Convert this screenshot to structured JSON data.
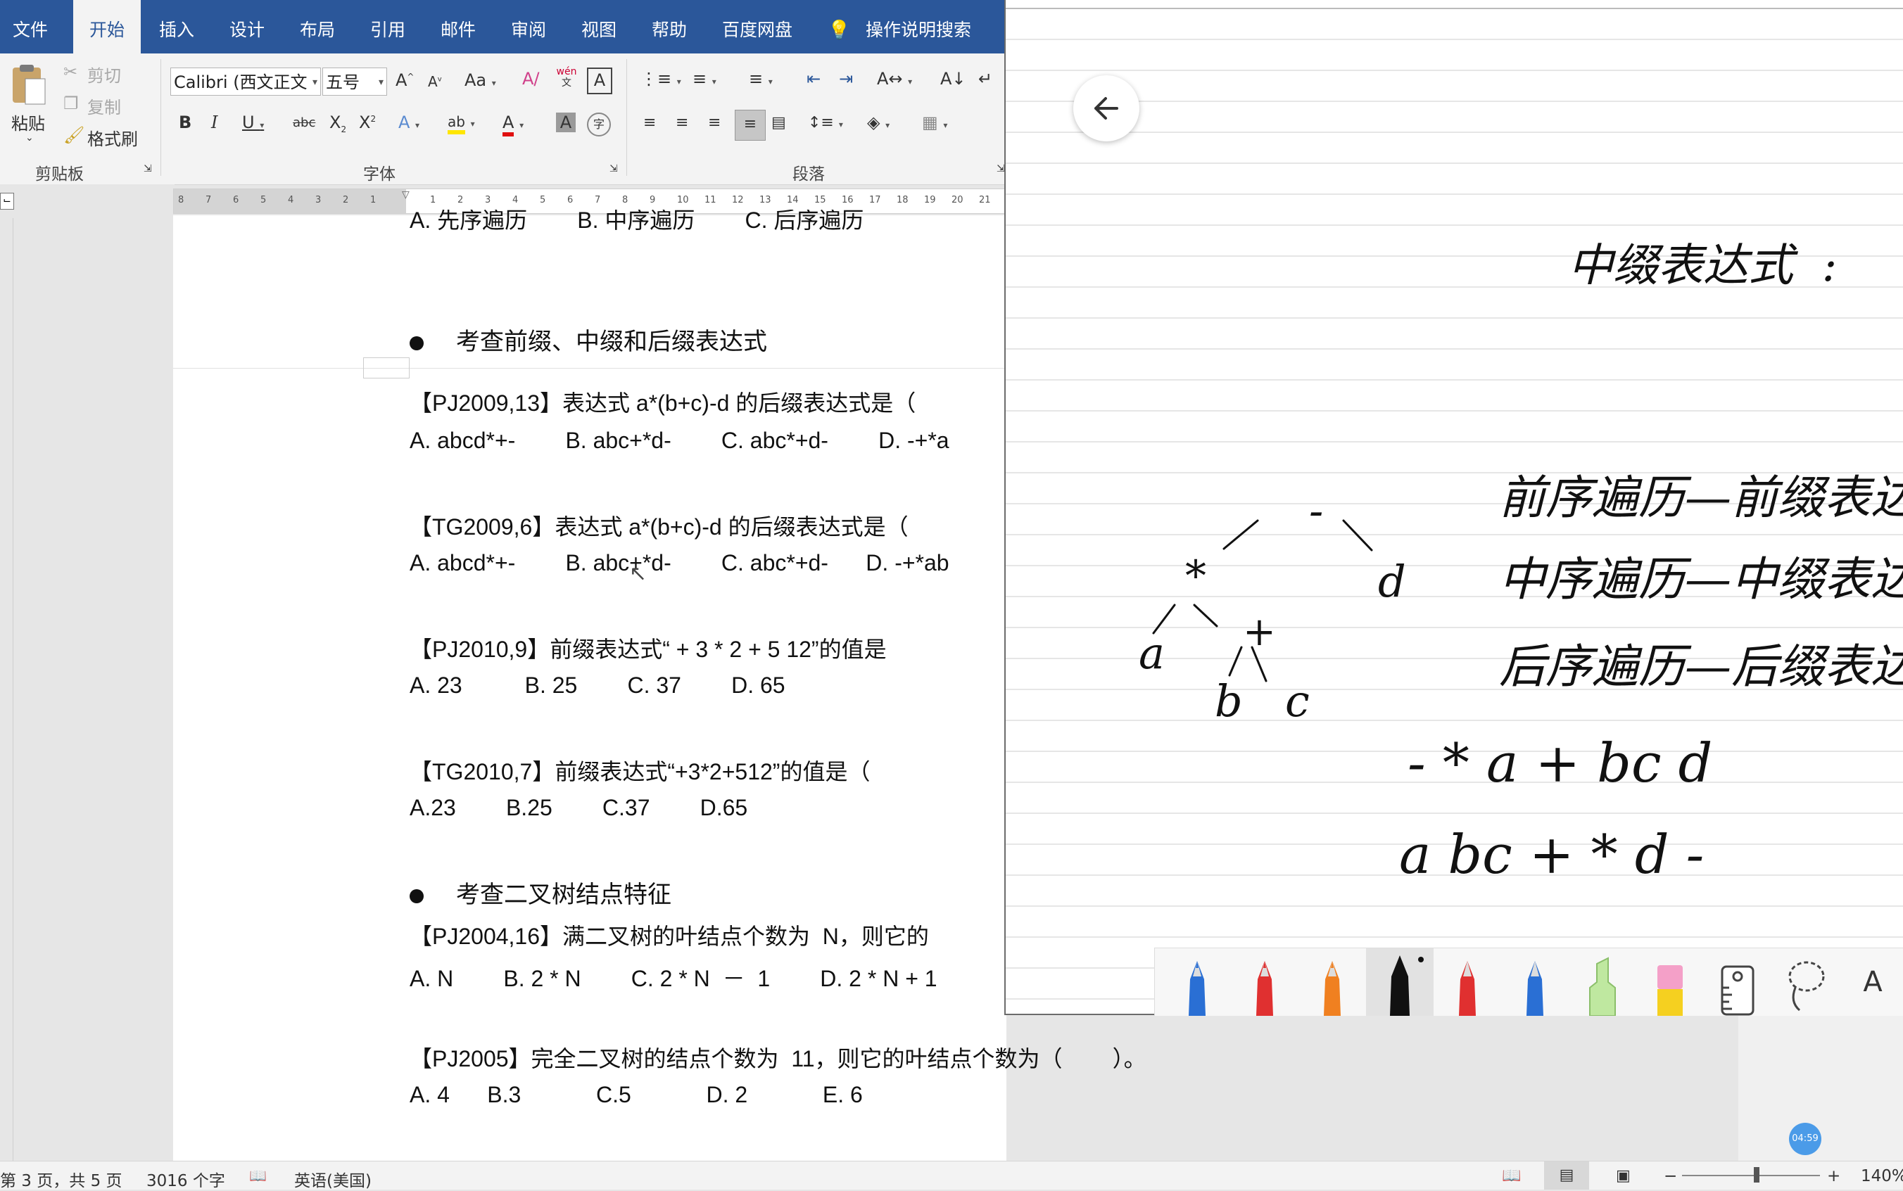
{
  "tabs": [
    "文件",
    "开始",
    "插入",
    "设计",
    "布局",
    "引用",
    "邮件",
    "审阅",
    "视图",
    "帮助",
    "百度网盘",
    "操作说明搜索"
  ],
  "ribbon": {
    "clipboard": {
      "paste": "粘贴",
      "cut": "剪切",
      "copy": "复制",
      "format_painter": "格式刷",
      "group_label": "剪贴板"
    },
    "font": {
      "name": "Calibri (西文正文",
      "size": "五号",
      "group_label": "字体",
      "phonetic_top": "wén",
      "phonetic_bottom": "文"
    },
    "paragraph": {
      "group_label": "段落"
    }
  },
  "ruler_numbers_left": [
    "8",
    "7",
    "6",
    "5",
    "4",
    "3",
    "2",
    "1"
  ],
  "ruler_numbers_right": [
    "1",
    "2",
    "3",
    "4",
    "5",
    "6",
    "7",
    "8",
    "9",
    "10",
    "11",
    "12",
    "13",
    "14",
    "15",
    "16",
    "17",
    "18",
    "19",
    "20",
    "21"
  ],
  "document": {
    "top_partial": "A. 先序遍历        B. 中序遍历        C. 后序遍历",
    "heading1": "考查前缀、中缀和后缀表达式",
    "q1": "【PJ2009,13】表达式 a*(b+c)-d 的后缀表达式是（",
    "q1_opts": "A. abcd*+-        B. abc+*d-        C. abc*+d-        D. -+*a",
    "q2": "【TG2009,6】表达式 a*(b+c)-d 的后缀表达式是（",
    "q2_opts": "A. abcd*+-        B. abc+*d-        C. abc*+d-      D. -+*ab",
    "q3": "【PJ2010,9】前缀表达式“ + 3 * 2 + 5 12”的值是",
    "q3_opts": "A. 23          B. 25        C. 37        D. 65",
    "q4": "【TG2010,7】前缀表达式“+3*2+512”的值是（",
    "q4_opts": "A.23        B.25        C.37        D.65",
    "heading2": "考查二叉树结点特征",
    "q5": "【PJ2004,16】满二叉树的叶结点个数为  N，则它的",
    "q5_opts": "A. N        B. 2 * N        C. 2 * N  －  1        D. 2 * N + 1",
    "q6": "【PJ2005】完全二叉树的结点个数为  11，则它的叶结点个数为（        ）。",
    "q6_opts": "A. 4      B.3            C.5            D. 2            E. 6"
  },
  "status": {
    "page": "第 3 页，共 5 页",
    "words": "3016 个字",
    "language": "英语(美国)",
    "zoom": "140%"
  },
  "timer": "04:59",
  "board_handwriting": [
    "中缀表达式",
    "前序遍历—前缀表达",
    "中序遍历—中缀表达",
    "后序遍历—后缀表达",
    "- * a + bc d",
    "a bc + * d -"
  ],
  "board_tree_nodes": [
    "-",
    "*",
    "d",
    "a",
    "+",
    "b",
    "c"
  ],
  "board_tools": [
    "blue-pen",
    "red-pen",
    "orange-pen",
    "black-marker",
    "red-pen-2",
    "blue-pen-2",
    "green-highlighter",
    "yellow-highlighter",
    "ruler",
    "lasso",
    "text"
  ],
  "board_tool_text": "A",
  "colors": {
    "ribbon_blue": "#2b579a",
    "ink": "#111111"
  }
}
